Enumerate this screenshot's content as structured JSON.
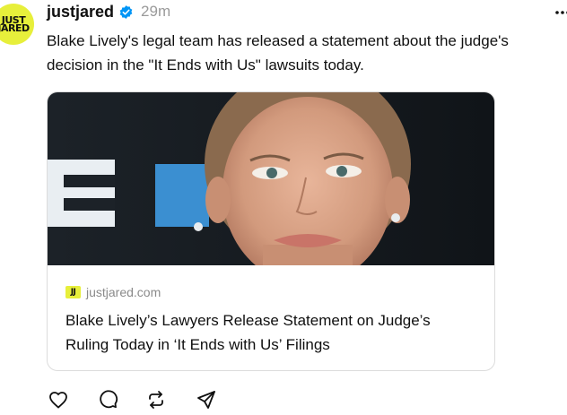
{
  "post": {
    "avatar": {
      "line1": "JUST",
      "line2": "JARED",
      "color": "#e7ef3b",
      "icon": "justjared-logo-avatar"
    },
    "username": "justjared",
    "verified_icon": "verified-badge-icon",
    "time": "29m",
    "more_icon": "more-dots-icon",
    "text_lines": [
      "Blake Lively's legal team has released a statement about the judge's",
      "decision in the \"It Ends with Us\" lawsuits today."
    ]
  },
  "link_card": {
    "image_icon": "article-photo",
    "favicon": "JJ",
    "domain": "justjared.com",
    "title_lines": [
      "Blake Lively’s Lawyers Release Statement on Judge’s",
      "Ruling Today in ‘It Ends with Us’ Filings"
    ]
  },
  "actions": [
    {
      "icon": "heart-icon",
      "label": "like"
    },
    {
      "icon": "comment-icon",
      "label": "reply"
    },
    {
      "icon": "repost-icon",
      "label": "repost"
    },
    {
      "icon": "share-icon",
      "label": "share"
    }
  ],
  "colors": {
    "brand_yellow": "#e7ef3b",
    "verified_blue": "#0095f6",
    "muted_text": "#9a9a9a"
  }
}
